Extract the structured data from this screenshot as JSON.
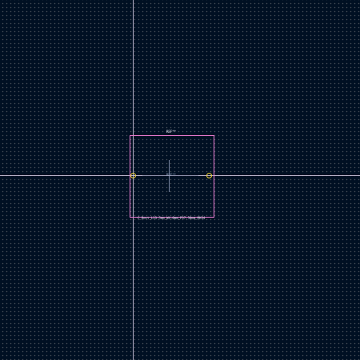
{
  "editor": {
    "footprint": {
      "reference_top": "REF**",
      "reference_center": "REF**",
      "value": "C_Rect_L13.5mm_W4.0mm_P37.50mm_MKS4"
    },
    "colors": {
      "background": "#001023",
      "grid_dot": "#848484",
      "crosshair": "#d8cfe6",
      "courtyard": "#e87bd0",
      "pad_outline": "#f2d23a"
    }
  }
}
